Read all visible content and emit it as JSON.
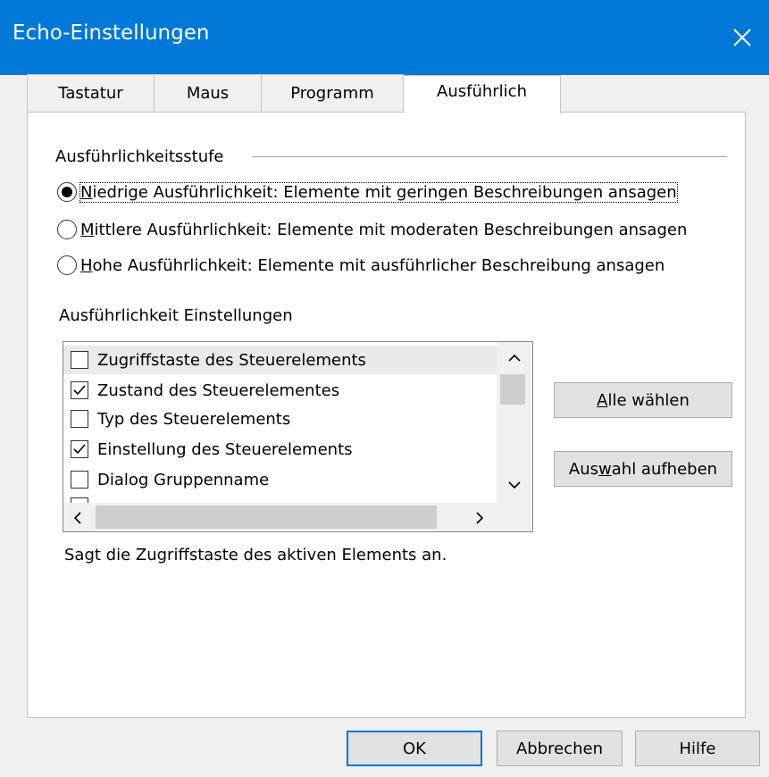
{
  "window": {
    "title": "Echo-Einstellungen"
  },
  "tabs": [
    "Tastatur",
    "Maus",
    "Programm",
    "Ausführlich"
  ],
  "verbosity": {
    "group_label": "Ausführlichkeitsstufe",
    "options": [
      {
        "mnemonic": "N",
        "rest": "iedrige Ausführlichkeit: Elemente mit geringen Beschreibungen ansagen",
        "selected": true
      },
      {
        "mnemonic": "M",
        "rest": "ittlere Ausführlichkeit: Elemente mit moderaten Beschreibungen ansagen",
        "selected": false
      },
      {
        "mnemonic": "H",
        "rest": "ohe Ausführlichkeit: Elemente mit ausführlicher Beschreibung ansagen",
        "selected": false
      }
    ]
  },
  "settings": {
    "group_label": "Ausführlichkeit Einstellungen",
    "items": [
      {
        "label": "Zugriffstaste des Steuerelements",
        "checked": false
      },
      {
        "label": "Zustand des Steuerelementes",
        "checked": true
      },
      {
        "label": "Typ des Steuerelements",
        "checked": false
      },
      {
        "label": "Einstellung des Steuerelements",
        "checked": true
      },
      {
        "label": "Dialog Gruppenname",
        "checked": false
      }
    ],
    "select_all": {
      "mnemonic": "A",
      "rest": "lle wählen"
    },
    "deselect": {
      "pre": "Aus",
      "mnemonic": "w",
      "rest": "ahl aufheben"
    },
    "description": "Sagt die Zugriffstaste des aktiven Elements an."
  },
  "buttons": {
    "ok": "OK",
    "cancel": "Abbrechen",
    "help": "Hilfe"
  },
  "colors": {
    "titlebar": "#0078d7",
    "focus_border": "#0078d7"
  }
}
